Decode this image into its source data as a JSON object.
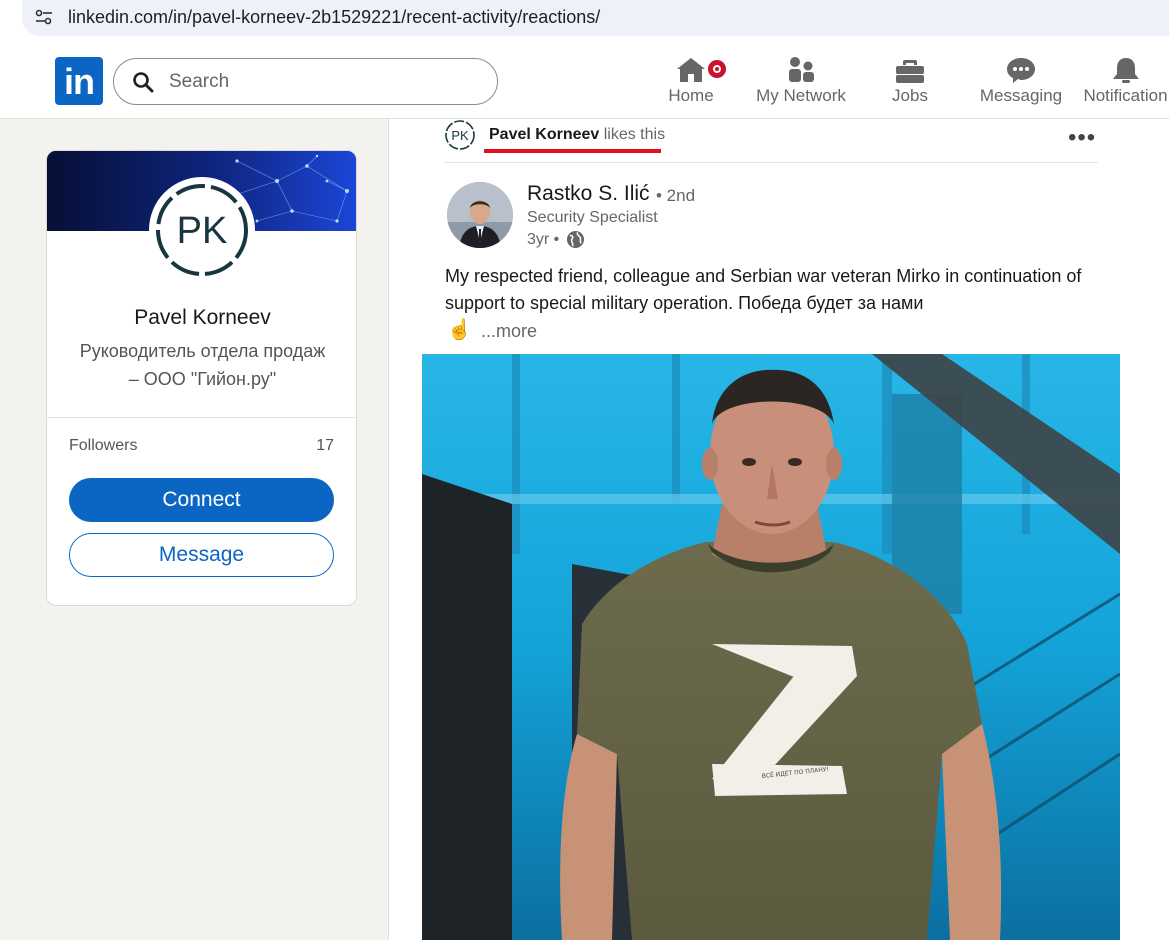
{
  "browser": {
    "url": "linkedin.com/in/pavel-korneev-2b1529221/recent-activity/reactions/"
  },
  "nav": {
    "logo_text": "in",
    "search_placeholder": "Search",
    "items": [
      {
        "label": "Home",
        "icon": "home-icon"
      },
      {
        "label": "My Network",
        "icon": "network-icon"
      },
      {
        "label": "Jobs",
        "icon": "briefcase-icon"
      },
      {
        "label": "Messaging",
        "icon": "messaging-icon"
      },
      {
        "label": "Notification",
        "icon": "bell-icon"
      }
    ]
  },
  "profile": {
    "initials": "PK",
    "name": "Pavel Korneev",
    "headline": "Руководитель отдела продаж – ООО \"Гийон.ру\"",
    "followers_label": "Followers",
    "followers_count": "17",
    "connect_label": "Connect",
    "message_label": "Message"
  },
  "activity": {
    "actor": "Pavel Korneev",
    "action": " likes this",
    "menu_icon": "more-dots-icon"
  },
  "post": {
    "author": "Rastko S. Ilić",
    "degree": "• 2nd",
    "author_title": "Security Specialist",
    "time": "3yr •",
    "text": "My respected friend, colleague and Serbian war veteran Mirko in continuation of support to special military operation. Победа будет за нами",
    "emoji": "☝",
    "more_label": "...more",
    "shirt_text": "ВСЁ ИДЁТ ПО ПЛАНУ!"
  },
  "colors": {
    "brand": "#0a66c2",
    "notification_badge": "#cb112d",
    "highlight_underline": "#e0101e"
  }
}
